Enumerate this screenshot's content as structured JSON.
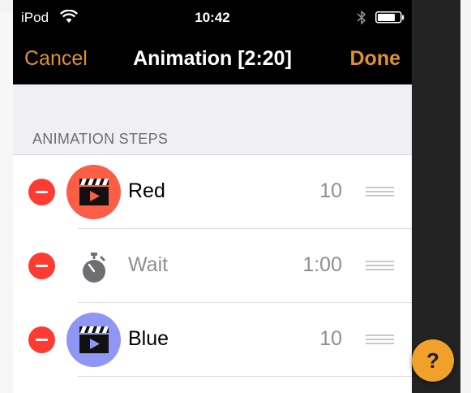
{
  "status_bar": {
    "carrier": "iPod",
    "time": "10:42",
    "icons": [
      "wifi-icon",
      "bluetooth-icon",
      "battery-icon"
    ]
  },
  "nav": {
    "cancel_label": "Cancel",
    "title": "Animation [2:20]",
    "done_label": "Done"
  },
  "section": {
    "header": "ANIMATION STEPS"
  },
  "steps": [
    {
      "label": "Red",
      "value": "10",
      "type": "scene",
      "icon": "clapperboard-icon",
      "thumb_color": "#fb5d45"
    },
    {
      "label": "Wait",
      "value": "1:00",
      "type": "wait",
      "icon": "stopwatch-icon"
    },
    {
      "label": "Blue",
      "value": "10",
      "type": "scene",
      "icon": "clapperboard-icon",
      "thumb_color": "#8f96f4"
    }
  ],
  "help_button": {
    "label": "?"
  },
  "colors": {
    "accent": "#e0912f",
    "delete": "#fd3b30",
    "help": "#f1a12a"
  }
}
